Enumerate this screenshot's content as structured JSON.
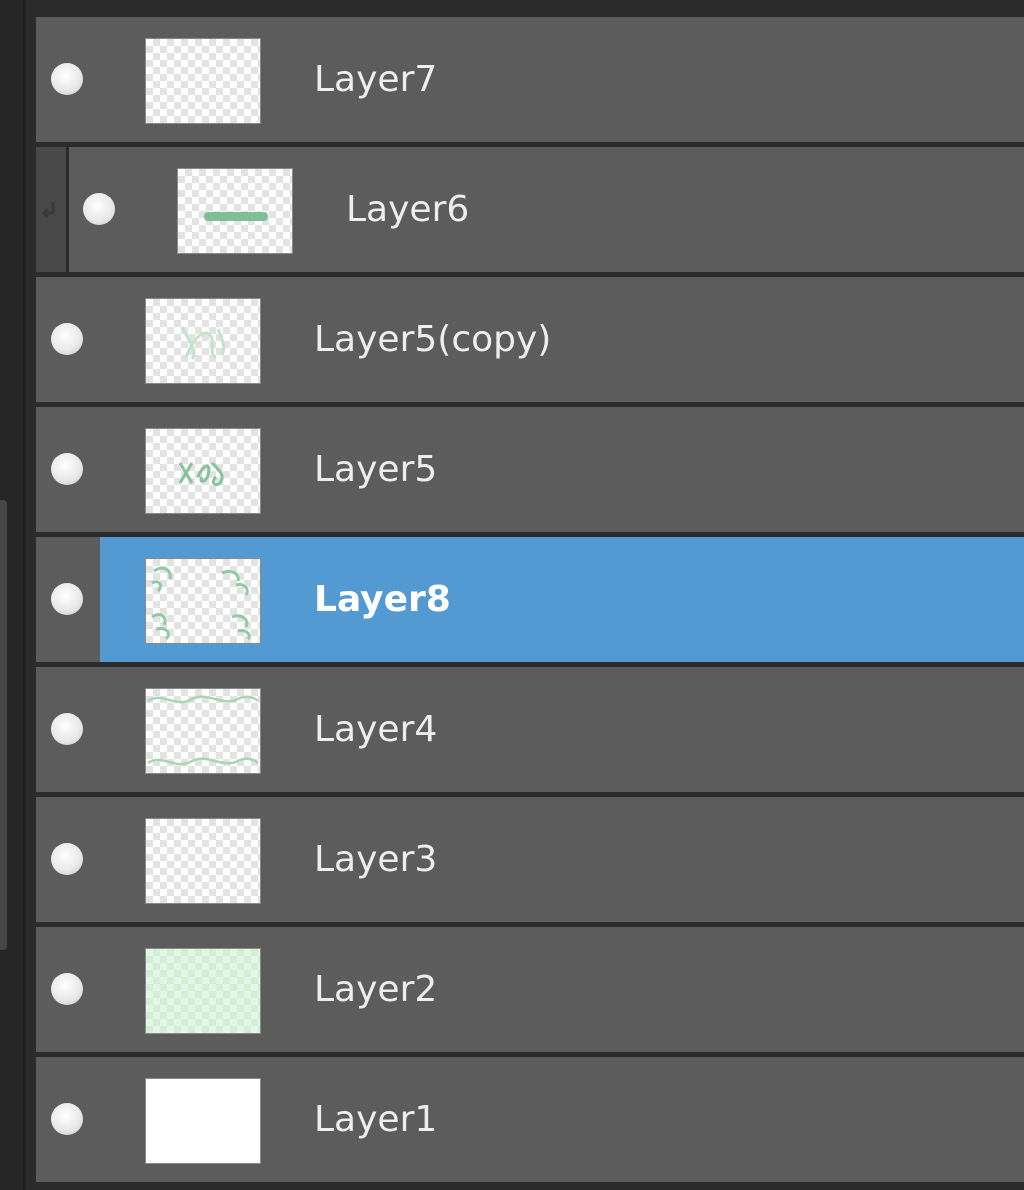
{
  "layers_panel": {
    "layers": [
      {
        "name": "Layer7",
        "thumbnail": "empty",
        "clipped": false,
        "selected": false
      },
      {
        "name": "Layer6",
        "thumbnail": "green-stroke",
        "clipped": true,
        "selected": false
      },
      {
        "name": "Layer5(copy)",
        "thumbnail": "faint-scribble",
        "clipped": false,
        "selected": false
      },
      {
        "name": "Layer5",
        "thumbnail": "scribble",
        "clipped": false,
        "selected": false
      },
      {
        "name": "Layer8",
        "thumbnail": "corner-leaves",
        "clipped": false,
        "selected": true
      },
      {
        "name": "Layer4",
        "thumbnail": "wavy-border",
        "clipped": false,
        "selected": false
      },
      {
        "name": "Layer3",
        "thumbnail": "empty",
        "clipped": false,
        "selected": false
      },
      {
        "name": "Layer2",
        "thumbnail": "light-green-fill",
        "clipped": false,
        "selected": false
      },
      {
        "name": "Layer1",
        "thumbnail": "white-fill",
        "clipped": false,
        "selected": false
      }
    ],
    "colors": {
      "row_background": "#5c5c5c",
      "selected_background": "#549ad2",
      "panel_background": "#2b2b2b",
      "label_text": "#eeeeee",
      "thumbnail_ink": "#7fbf95"
    },
    "icons": {
      "visibility": "eye-toggle-dot-icon",
      "clipping": "clipping-arrow-icon"
    }
  }
}
